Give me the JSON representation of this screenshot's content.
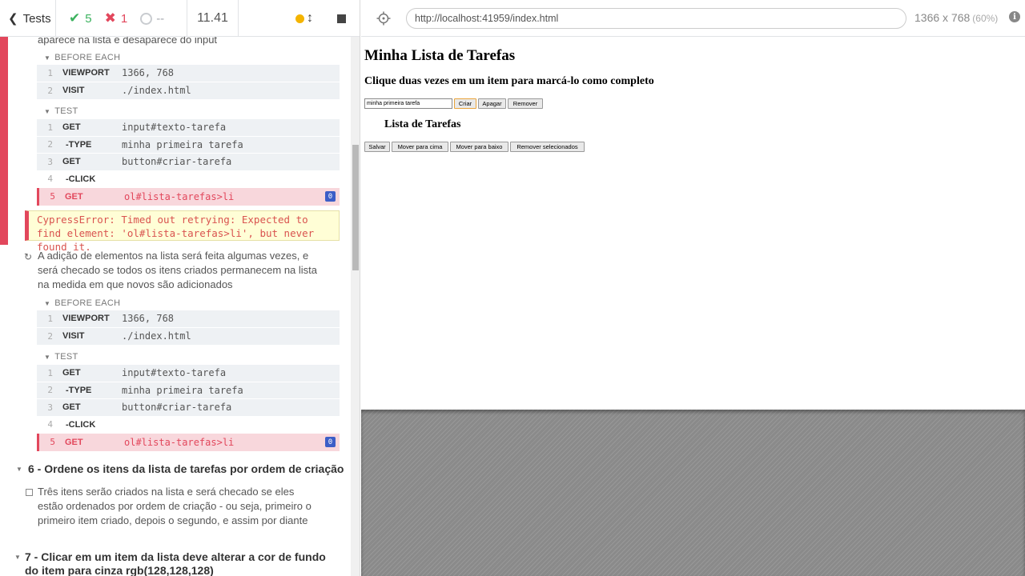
{
  "reporter": {
    "header": {
      "tests_label": "Tests",
      "passed": "5",
      "failed": "1",
      "pending": "--",
      "duration": "11.41",
      "running_color": "#f4b400"
    },
    "test1": {
      "title_tail": "aparece na lista e desaparece do input",
      "before_each": {
        "label": "BEFORE EACH",
        "commands": [
          {
            "num": "1",
            "name": "VIEWPORT",
            "message": "1366, 768"
          },
          {
            "num": "2",
            "name": "VISIT",
            "message": "./index.html"
          }
        ]
      },
      "test": {
        "label": "TEST",
        "commands": [
          {
            "num": "1",
            "name": "GET",
            "message": "input#texto-tarefa"
          },
          {
            "num": "2",
            "name": "-TYPE",
            "message": "minha primeira tarefa"
          },
          {
            "num": "3",
            "name": "GET",
            "message": "button#criar-tarefa"
          },
          {
            "num": "4",
            "name": "-CLICK",
            "message": ""
          },
          {
            "num": "5",
            "name": "GET",
            "message": "ol#lista-tarefas>li",
            "badge": "0"
          }
        ]
      },
      "error": "CypressError: Timed out retrying: Expected to find element: 'ol#lista-tarefas>li', but never found it."
    },
    "test2": {
      "title": "A adição de elementos na lista será feita algumas vezes, e será checado se todos os itens criados permanecem na lista na medida em que novos são adicionados",
      "before_each": {
        "label": "BEFORE EACH",
        "commands": [
          {
            "num": "1",
            "name": "VIEWPORT",
            "message": "1366, 768"
          },
          {
            "num": "2",
            "name": "VISIT",
            "message": "./index.html"
          }
        ]
      },
      "test": {
        "label": "TEST",
        "commands": [
          {
            "num": "1",
            "name": "GET",
            "message": "input#texto-tarefa"
          },
          {
            "num": "2",
            "name": "-TYPE",
            "message": "minha primeira tarefa"
          },
          {
            "num": "3",
            "name": "GET",
            "message": "button#criar-tarefa"
          },
          {
            "num": "4",
            "name": "-CLICK",
            "message": ""
          },
          {
            "num": "5",
            "name": "GET",
            "message": "ol#lista-tarefas>li",
            "badge": "0"
          }
        ]
      }
    },
    "suite6": {
      "title": "6 - Ordene os itens da lista de tarefas por ordem de criação",
      "test_title": "Três itens serão criados na lista e será checado se eles estão ordenados por ordem de criação - ou seja, primeiro o primeiro item criado, depois o segundo, e assim por diante"
    },
    "suite7": {
      "title": "7 - Clicar em um item da lista deve alterar a cor de fundo do item para cinza rgb(128,128,128)"
    }
  },
  "aut": {
    "url": "http://localhost:41959/index.html",
    "viewport": "1366 x 768",
    "scale": "(60%)",
    "page": {
      "h1": "Minha Lista de Tarefas",
      "h2": "Clique duas vezes em um item para marcá-lo como completo",
      "input_value": "minha primeira tarefa",
      "btn_criar": "Criar",
      "btn_apagar": "Apagar",
      "btn_remover": "Remover",
      "list_title": "Lista de Tarefas",
      "btn_salvar": "Salvar",
      "btn_cima": "Mover para cima",
      "btn_baixo": "Mover para baixo",
      "btn_remover_sel": "Remover selecionados"
    }
  }
}
